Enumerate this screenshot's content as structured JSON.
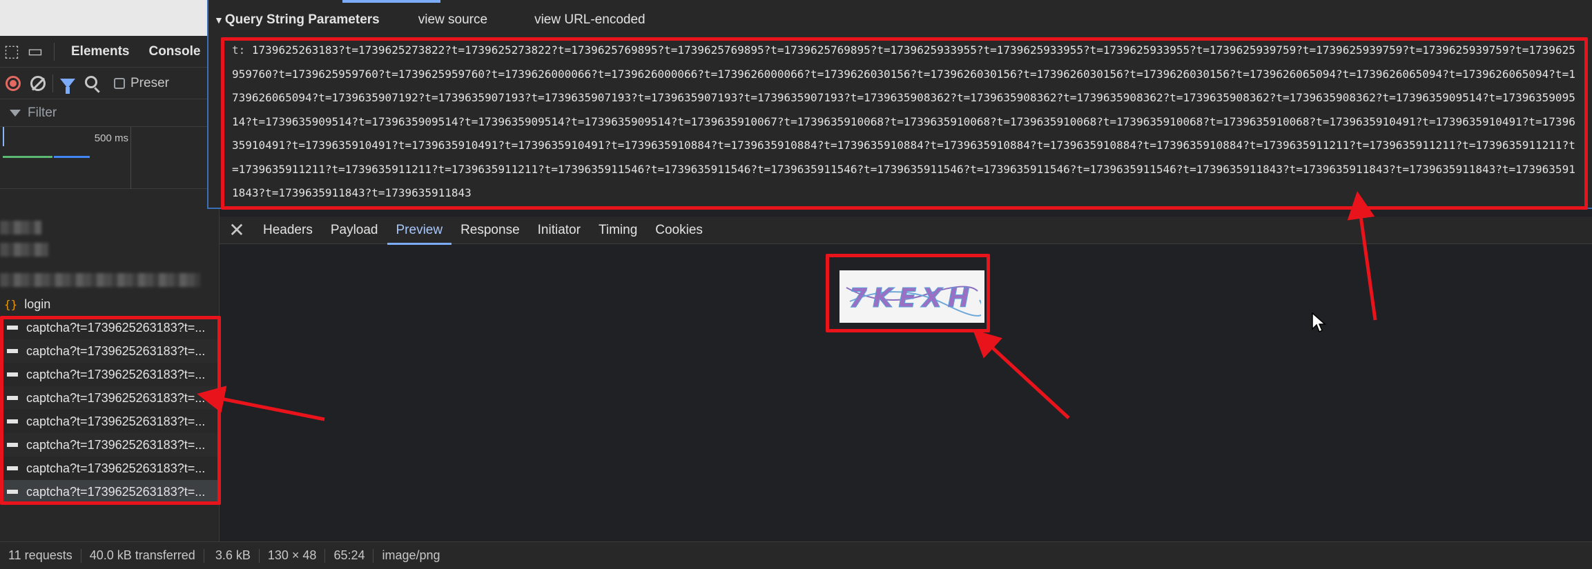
{
  "devtools": {
    "tabs": {
      "elements": "Elements",
      "console": "Console"
    },
    "network": {
      "preserve_log": "Preser",
      "filter_placeholder": "Filter",
      "timeline_label": "500 ms"
    }
  },
  "payload": {
    "section_title": "Query String Parameters",
    "view_source": "view source",
    "view_url_encoded": "view URL-encoded",
    "param_key": "t:",
    "param_value": "1739625263183?t=1739625273822?t=1739625273822?t=1739625769895?t=1739625769895?t=1739625769895?t=1739625933955?t=1739625933955?t=1739625933955?t=1739625939759?t=1739625939759?t=1739625939759?t=1739625959760?t=1739625959760?t=1739625959760?t=1739626000066?t=1739626000066?t=1739626000066?t=1739626030156?t=1739626030156?t=1739626030156?t=1739626030156?t=1739626065094?t=1739626065094?t=1739626065094?t=1739626065094?t=1739635907192?t=1739635907193?t=1739635907193?t=1739635907193?t=1739635907193?t=1739635908362?t=1739635908362?t=1739635908362?t=1739635908362?t=1739635908362?t=1739635909514?t=1739635909514?t=1739635909514?t=1739635909514?t=1739635909514?t=1739635909514?t=1739635910067?t=1739635910068?t=1739635910068?t=1739635910068?t=1739635910068?t=1739635910068?t=1739635910491?t=1739635910491?t=1739635910491?t=1739635910491?t=1739635910491?t=1739635910491?t=1739635910884?t=1739635910884?t=1739635910884?t=1739635910884?t=1739635910884?t=1739635910884?t=1739635911211?t=1739635911211?t=1739635911211?t=1739635911211?t=1739635911211?t=1739635911211?t=1739635911546?t=1739635911546?t=1739635911546?t=1739635911546?t=1739635911546?t=1739635911546?t=1739635911843?t=1739635911843?t=1739635911843?t=1739635911843?t=1739635911843?t=1739635911843"
  },
  "requests": {
    "login": "login",
    "items": [
      "captcha?t=1739625263183?t=...",
      "captcha?t=1739625263183?t=...",
      "captcha?t=1739625263183?t=...",
      "captcha?t=1739625263183?t=...",
      "captcha?t=1739625263183?t=...",
      "captcha?t=1739625263183?t=...",
      "captcha?t=1739625263183?t=...",
      "captcha?t=1739625263183?t=..."
    ]
  },
  "detail_tabs": {
    "headers": "Headers",
    "payload": "Payload",
    "preview": "Preview",
    "response": "Response",
    "initiator": "Initiator",
    "timing": "Timing",
    "cookies": "Cookies"
  },
  "captcha": {
    "text": "7KEXH"
  },
  "status": {
    "requests": "11 requests",
    "transferred": "40.0 kB transferred",
    "size": "3.6 kB",
    "dimensions": "130 × 48",
    "ratio": "65:24",
    "mime": "image/png"
  },
  "colors": {
    "annotation_red": "#e8131b",
    "accent_blue": "#7cacf8"
  }
}
